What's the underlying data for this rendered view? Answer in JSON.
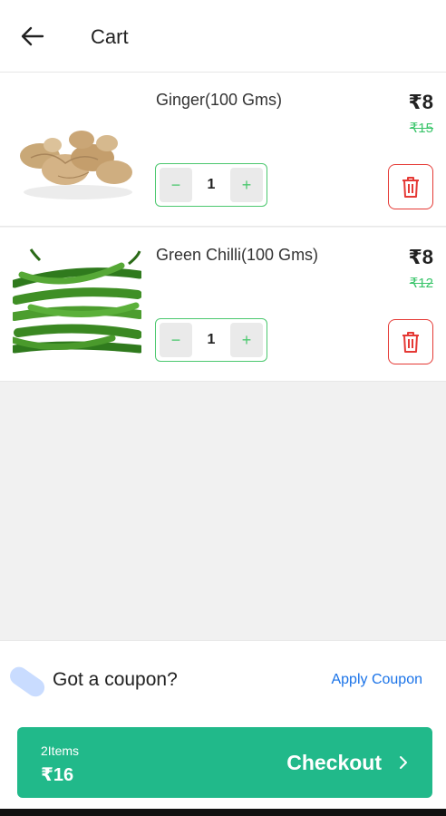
{
  "header": {
    "title": "Cart",
    "back_icon": "arrow-left-icon"
  },
  "cart": {
    "items": [
      {
        "name": "Ginger(100 Gms)",
        "price": "₹8",
        "mrp": "₹15",
        "quantity": "1",
        "decrement": "−",
        "increment": "+",
        "image": "ginger-image"
      },
      {
        "name": "Green Chilli(100 Gms)",
        "price": "₹8",
        "mrp": "₹12",
        "quantity": "1",
        "decrement": "−",
        "increment": "+",
        "image": "green-chilli-image"
      }
    ]
  },
  "coupon": {
    "text": "Got a coupon?",
    "action": "Apply Coupon",
    "icon": "coupon-tag-icon"
  },
  "checkout": {
    "item_count": "2Items",
    "total": "₹16",
    "label": "Checkout",
    "icon": "chevron-right-icon"
  },
  "colors": {
    "accent_green": "#21b98a",
    "stepper_green": "#4cc86f",
    "delete_red": "#e53935",
    "link_blue": "#1a73e8"
  }
}
